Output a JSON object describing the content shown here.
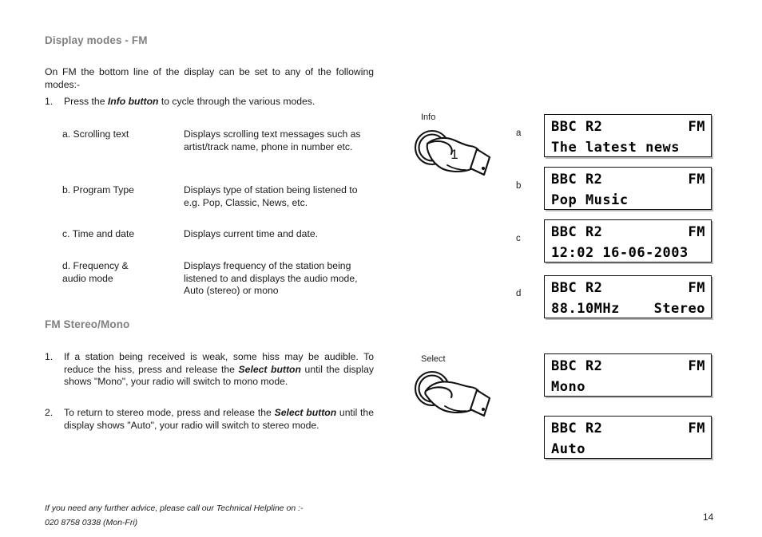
{
  "document": {
    "page_number": "14"
  },
  "sections": {
    "display_modes": {
      "heading": "Display modes - FM",
      "intro": "On FM the bottom line of the display can be set to any of the following modes:-",
      "step": {
        "number": "1.",
        "text_before": "Press the ",
        "emphasis": "Info button",
        "text_after": " to cycle through the various modes."
      },
      "modes": [
        {
          "letter": "a",
          "term": "a. Scrolling text",
          "description": "Displays scrolling text messages such as artist/track name, phone in number etc."
        },
        {
          "letter": "b",
          "term": "b. Program Type",
          "description": "Displays type of station being listened to e.g. Pop, Classic, News, etc."
        },
        {
          "letter": "c",
          "term": "c. Time and date",
          "description": "Displays current time and date."
        },
        {
          "letter": "d",
          "term": "d. Frequency &\n    audio mode",
          "description": "Displays frequency of the station being listened to and displays the audio mode, Auto (stereo) or mono"
        }
      ]
    },
    "fm_stereo_mono": {
      "heading": "FM Stereo/Mono",
      "steps": [
        {
          "number": "1.",
          "text_before": "If a station being received is weak, some hiss may be audible. To reduce the hiss, press and release the ",
          "emphasis": "Select button",
          "text_after": " until the display shows \"Mono\", your radio will switch to mono mode."
        },
        {
          "number": "2.",
          "text_before": "To return to stereo mode, press and release the ",
          "emphasis": "Select button",
          "text_after": " until the display shows \"Auto\", your radio will switch to stereo mode."
        }
      ]
    }
  },
  "illustrations": [
    {
      "name": "info-button-press",
      "caption": "Info",
      "knob_label": "1"
    },
    {
      "name": "select-button-press",
      "caption": "Select",
      "knob_label": ""
    }
  ],
  "displays": [
    {
      "id": "a",
      "top_left": "BBC R2",
      "top_right": "FM",
      "bottom": "The latest news"
    },
    {
      "id": "b",
      "top_left": "BBC R2",
      "top_right": "FM",
      "bottom": "Pop Music"
    },
    {
      "id": "c",
      "top_left": "BBC R2",
      "top_right": "FM",
      "bottom": "12:02 16-06-2003"
    },
    {
      "id": "d",
      "top_left": "BBC R2",
      "top_right": "FM",
      "bottom_left": "88.10MHz",
      "bottom_right": "Stereo"
    },
    {
      "id": "mono",
      "top_left": "BBC R2",
      "top_right": "FM",
      "bottom": "Mono"
    },
    {
      "id": "auto",
      "top_left": "BBC R2",
      "top_right": "FM",
      "bottom": "Auto"
    }
  ],
  "footer": {
    "line1": "If you need any further advice, please call our Technical Helpline on :-",
    "line2": "020 8758 0338 (Mon-Fri)"
  },
  "colors": {
    "heading_gray": "#808080",
    "body_text": "#1a1a1a",
    "lcd_border": "#111111",
    "lcd_background": "#ffffff"
  }
}
